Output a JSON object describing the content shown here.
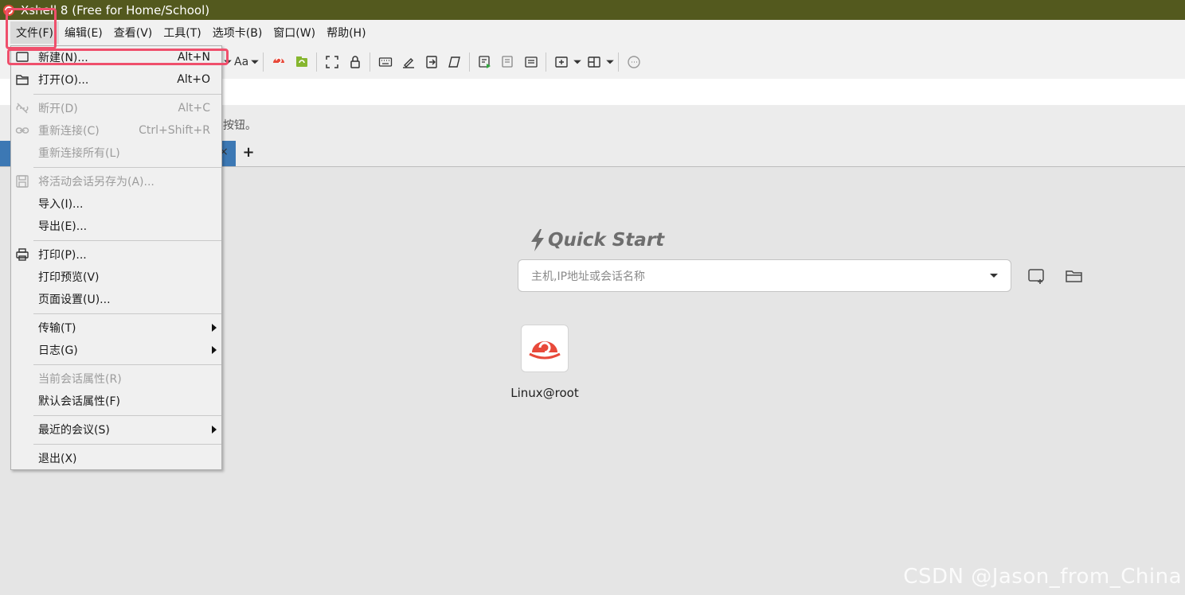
{
  "window": {
    "title": "Xshell 8 (Free for Home/School)"
  },
  "menubar": {
    "items": [
      "文件(F)",
      "编辑(E)",
      "查看(V)",
      "工具(T)",
      "选项卡(B)",
      "窗口(W)",
      "帮助(H)"
    ]
  },
  "toolbar": {
    "font_label": "Aa"
  },
  "hint": {
    "text": "按钮。"
  },
  "tabs": {
    "add_label": "+",
    "close_label": "×"
  },
  "file_menu": {
    "items": [
      {
        "label": "新建(N)...",
        "shortcut": "Alt+N",
        "enabled": true,
        "icon": "new-session-icon"
      },
      {
        "label": "打开(O)...",
        "shortcut": "Alt+O",
        "enabled": true,
        "icon": "folder-open-icon"
      },
      {
        "label": "断开(D)",
        "shortcut": "Alt+C",
        "enabled": false,
        "icon": "disconnect-icon"
      },
      {
        "label": "重新连接(C)",
        "shortcut": "Ctrl+Shift+R",
        "enabled": false,
        "icon": "link-icon"
      },
      {
        "label": "重新连接所有(L)",
        "shortcut": "",
        "enabled": false,
        "icon": ""
      },
      {
        "label": "将活动会话另存为(A)...",
        "shortcut": "",
        "enabled": false,
        "icon": "save-icon"
      },
      {
        "label": "导入(I)...",
        "shortcut": "",
        "enabled": true,
        "icon": ""
      },
      {
        "label": "导出(E)...",
        "shortcut": "",
        "enabled": true,
        "icon": ""
      },
      {
        "label": "打印(P)...",
        "shortcut": "",
        "enabled": true,
        "icon": "printer-icon"
      },
      {
        "label": "打印预览(V)",
        "shortcut": "",
        "enabled": true,
        "icon": ""
      },
      {
        "label": "页面设置(U)...",
        "shortcut": "",
        "enabled": true,
        "icon": ""
      },
      {
        "label": "传输(T)",
        "shortcut": "",
        "enabled": true,
        "icon": "",
        "submenu": true
      },
      {
        "label": "日志(G)",
        "shortcut": "",
        "enabled": true,
        "icon": "",
        "submenu": true
      },
      {
        "label": "当前会话属性(R)",
        "shortcut": "",
        "enabled": false,
        "icon": ""
      },
      {
        "label": "默认会话属性(F)",
        "shortcut": "",
        "enabled": true,
        "icon": ""
      },
      {
        "label": "最近的会议(S)",
        "shortcut": "",
        "enabled": true,
        "icon": "",
        "submenu": true
      },
      {
        "label": "退出(X)",
        "shortcut": "",
        "enabled": true,
        "icon": ""
      }
    ]
  },
  "quick_start": {
    "title": "Quick Start",
    "placeholder": "主机,IP地址或会话名称",
    "session_label": "Linux@root"
  },
  "watermark": "CSDN @Jason_from_China",
  "colors": {
    "titlebar": "#53591e",
    "highlight": "#ef4f6c",
    "tab_active": "#3c78b4",
    "brand_red": "#e8493a"
  }
}
